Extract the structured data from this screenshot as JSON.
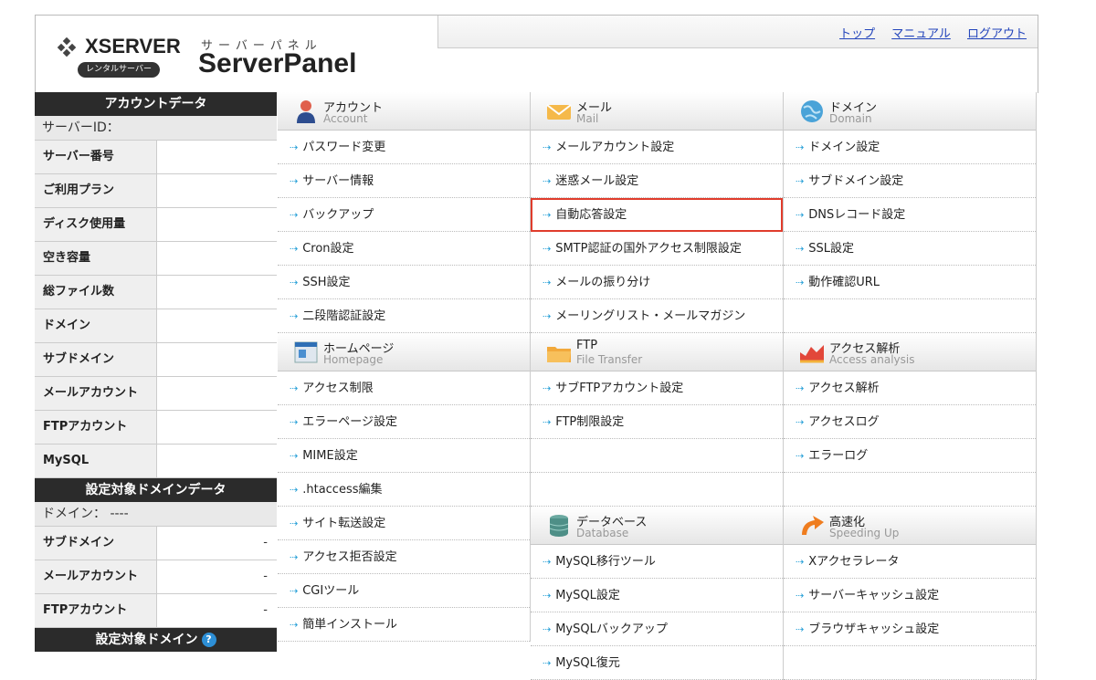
{
  "header": {
    "logo_word": "XSERVER",
    "logo_pill": "レンタルサーバー",
    "panel_kana": "サーバーパネル",
    "panel_title": "ServerPanel",
    "links": [
      "トップ",
      "マニュアル",
      "ログアウト"
    ]
  },
  "sidebar": {
    "account_heading": "アカウントデータ",
    "server_id_label": "サーバーID：",
    "account_rows": [
      {
        "label": "サーバー番号",
        "value": ""
      },
      {
        "label": "ご利用プラン",
        "value": ""
      },
      {
        "label": "ディスク使用量",
        "value": ""
      },
      {
        "label": "空き容量",
        "value": ""
      },
      {
        "label": "総ファイル数",
        "value": ""
      },
      {
        "label": "ドメイン",
        "value": ""
      },
      {
        "label": "サブドメイン",
        "value": ""
      },
      {
        "label": "メールアカウント",
        "value": ""
      },
      {
        "label": "FTPアカウント",
        "value": ""
      },
      {
        "label": "MySQL",
        "value": ""
      }
    ],
    "domain_heading": "設定対象ドメインデータ",
    "domain_label": "ドメイン： ----",
    "domain_rows": [
      {
        "label": "サブドメイン",
        "value": "-"
      },
      {
        "label": "メールアカウント",
        "value": "-"
      },
      {
        "label": "FTPアカウント",
        "value": "-"
      }
    ],
    "target_heading": "設定対象ドメイン",
    "help_glyph": "?"
  },
  "menu": {
    "account": {
      "title": "アカウント",
      "sub": "Account",
      "items": [
        "パスワード変更",
        "サーバー情報",
        "バックアップ",
        "Cron設定",
        "SSH設定",
        "二段階認証設定"
      ]
    },
    "homepage": {
      "title": "ホームページ",
      "sub": "Homepage",
      "items": [
        "アクセス制限",
        "エラーページ設定",
        "MIME設定",
        ".htaccess編集",
        "サイト転送設定",
        "アクセス拒否設定",
        "CGIツール",
        "簡単インストール"
      ]
    },
    "mail": {
      "title": "メール",
      "sub": "Mail",
      "items": [
        "メールアカウント設定",
        "迷惑メール設定",
        "自動応答設定",
        "SMTP認証の国外アクセス制限設定",
        "メールの振り分け",
        "メーリングリスト・メールマガジン"
      ]
    },
    "ftp": {
      "title": "FTP",
      "sub": "File Transfer",
      "items": [
        "サブFTPアカウント設定",
        "FTP制限設定"
      ]
    },
    "database": {
      "title": "データベース",
      "sub": "Database",
      "items": [
        "MySQL移行ツール",
        "MySQL設定",
        "MySQLバックアップ",
        "MySQL復元"
      ]
    },
    "domain": {
      "title": "ドメイン",
      "sub": "Domain",
      "items": [
        "ドメイン設定",
        "サブドメイン設定",
        "DNSレコード設定",
        "SSL設定",
        "動作確認URL"
      ]
    },
    "analysis": {
      "title": "アクセス解析",
      "sub": "Access analysis",
      "items": [
        "アクセス解析",
        "アクセスログ",
        "エラーログ"
      ]
    },
    "speed": {
      "title": "高速化",
      "sub": "Speeding Up",
      "items": [
        "Xアクセラレータ",
        "サーバーキャッシュ設定",
        "ブラウザキャッシュ設定"
      ]
    }
  },
  "colors": {
    "accent_arrow": "#2aa1d8",
    "highlight": "#e03c2c",
    "link": "#2244bb",
    "dark_heading": "#2b2b2b"
  }
}
